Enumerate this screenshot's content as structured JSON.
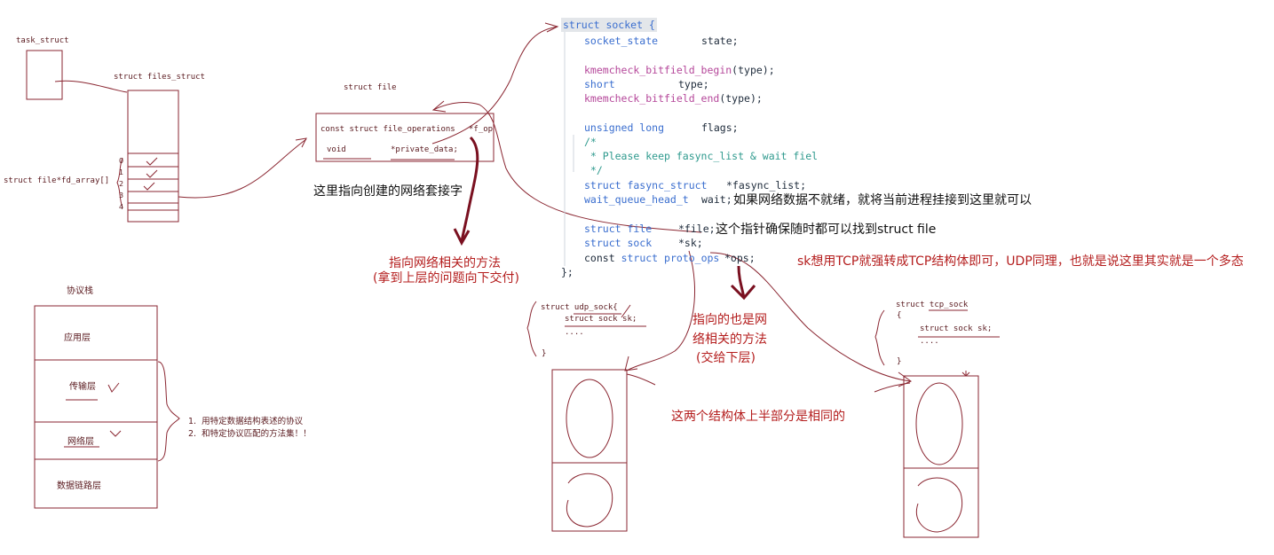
{
  "left": {
    "task_struct": "task_struct",
    "files_struct": "struct files_struct",
    "fd_array": "struct file*fd_array[]",
    "fd_indices": [
      "0",
      "1",
      "2",
      "3",
      "4"
    ]
  },
  "file": {
    "title": "struct file",
    "f_op_decl": "const struct file_operations",
    "f_op_name": "*f_op",
    "private_type": "void",
    "private_name": "*private_data;"
  },
  "protocol_stack": {
    "title": "协议栈",
    "layers": [
      "应用层",
      "传输层",
      "网络层",
      "数据链路层"
    ],
    "notes": [
      "1.  用特定数据结构表述的协议",
      "2.  和特定协议匹配的方法集！！"
    ]
  },
  "socket_code": {
    "header_kw": "struct socket {",
    "lines": {
      "state_type": "socket_state",
      "state_name": "state;",
      "kmem_begin": "kmemcheck_bitfield_begin",
      "kmem_begin_arg": "(type);",
      "short_type": "short",
      "short_name": "type;",
      "kmem_end": "kmemcheck_bitfield_end",
      "kmem_end_arg": "(type);",
      "flags_type": "unsigned long",
      "flags_name": "flags;",
      "comment1": "/*",
      "comment2": " * Please keep fasync_list & wait fiel",
      "comment3": " */",
      "fasync_type": "struct fasync_struct",
      "fasync_name": "*fasync_list;",
      "wait_type": "wait_queue_head_t",
      "wait_name": "wait;",
      "file_type": "struct file",
      "file_name": "*file;",
      "sock_type": "struct sock",
      "sock_name": "*sk;",
      "ops_const": "const",
      "ops_type": "struct proto_ops",
      "ops_name": "*ops;",
      "close": "};"
    }
  },
  "annotations": {
    "private_data_note": "这里指向创建的网络套接字",
    "fop_note_line1": "指向网络相关的方法",
    "fop_note_line2": "(拿到上层的问题向下交付)",
    "wait_note": "如果网络数据不就绪，就将当前进程挂接到这里就可以",
    "file_note": "这个指针确保随时都可以找到struct file",
    "sk_note": "sk想用TCP就强转成TCP结构体即可，UDP同理，也就是说这里其实就是一个多态",
    "ops_note_line1": "指向的也是网",
    "ops_note_line2": "络相关的方法",
    "ops_note_line3": "(交给下层)",
    "same_half_note": "这两个结构体上半部分是相同的"
  },
  "udp": {
    "header": "struct udp_sock{",
    "member": "struct sock sk;",
    "dots": "....",
    "close": "}"
  },
  "tcp": {
    "header": "struct tcp_sock",
    "open": "{",
    "member": "struct sock sk;",
    "dots": "....",
    "close": "}"
  },
  "colors": {
    "sketch": "#8a2631",
    "keyword": "#3a6ecf",
    "function": "#b5479a",
    "comment": "#2f9a8e",
    "note_red": "#b41d1d"
  }
}
